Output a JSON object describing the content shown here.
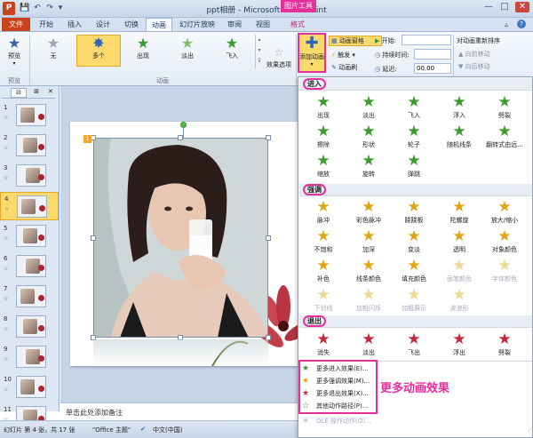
{
  "window": {
    "title": "ppt相册 - Microsoft PowerPoint",
    "logo_letter": "P",
    "contextual_tab_group": "图片工具",
    "min": "—",
    "max": "□",
    "close": "✕"
  },
  "quick_access": [
    "💾",
    "↶",
    "↷",
    "▾"
  ],
  "tabs": {
    "file": "文件",
    "items": [
      "开始",
      "插入",
      "设计",
      "切换",
      "动画",
      "幻灯片放映",
      "审阅",
      "视图"
    ],
    "format": "格式"
  },
  "ribbon": {
    "preview": {
      "label": "预览",
      "group": "预览"
    },
    "animations": [
      {
        "label": "无",
        "icon": "star-none"
      },
      {
        "label": "多个",
        "icon": "star-multi",
        "selected": true
      },
      {
        "label": "出现",
        "icon": "star-appear"
      },
      {
        "label": "淡出",
        "icon": "star-fade"
      },
      {
        "label": "飞入",
        "icon": "star-fly"
      }
    ],
    "effect_options": "效果选项",
    "group_animation": "动画",
    "add_animation": "添加动画",
    "animation_pane": "动画窗格",
    "trigger": "触发",
    "anim_painter": "动画刷",
    "start_label": "开始:",
    "start_value": "",
    "duration_label": "持续时间:",
    "duration_value": "",
    "delay_label": "延迟:",
    "delay_value": "00.00",
    "reorder": "对动画重新排序",
    "move_earlier": "向前移动",
    "move_later": "向后移动"
  },
  "left_pane": {
    "tabs": [
      "⊟",
      "⊞"
    ],
    "slides": [
      {
        "num": "1",
        "star": "☆"
      },
      {
        "num": "2",
        "star": "☆"
      },
      {
        "num": "3",
        "star": "☆"
      },
      {
        "num": "4",
        "star": "☆"
      },
      {
        "num": "5",
        "star": "☆"
      },
      {
        "num": "6",
        "star": "☆"
      },
      {
        "num": "7",
        "star": "☆"
      },
      {
        "num": "8",
        "star": "☆"
      },
      {
        "num": "9",
        "star": "☆"
      },
      {
        "num": "10",
        "star": "☆"
      },
      {
        "num": "11",
        "star": "☆"
      }
    ],
    "current_index": 3
  },
  "slide": {
    "anim_tag": "1"
  },
  "notes": {
    "placeholder": "单击此处添加备注"
  },
  "status": {
    "slide_info": "幻灯片 第 4 张，共 17 张",
    "theme": "\"Office 主题\"",
    "language": "中文(中国)"
  },
  "gallery": {
    "sections": {
      "entrance": "进入",
      "emphasis": "强调",
      "exit": "退出"
    },
    "entrance": [
      {
        "label": "出现",
        "icon": "star"
      },
      {
        "label": "淡出",
        "icon": "star"
      },
      {
        "label": "飞入",
        "icon": "star"
      },
      {
        "label": "浮入",
        "icon": "star"
      },
      {
        "label": "劈裂",
        "icon": "star"
      },
      {
        "label": "擦除",
        "icon": "star"
      },
      {
        "label": "形状",
        "icon": "star"
      },
      {
        "label": "轮子",
        "icon": "star"
      },
      {
        "label": "随机线条",
        "icon": "star"
      },
      {
        "label": "翻转式由远...",
        "icon": "star"
      },
      {
        "label": "缩放",
        "icon": "star"
      },
      {
        "label": "旋转",
        "icon": "star"
      },
      {
        "label": "弹跳",
        "icon": "star"
      }
    ],
    "emphasis": [
      {
        "label": "脉冲",
        "icon": "star",
        "disabled": false
      },
      {
        "label": "彩色脉冲",
        "icon": "star",
        "disabled": false
      },
      {
        "label": "跷跷板",
        "icon": "star",
        "disabled": false
      },
      {
        "label": "陀螺旋",
        "icon": "star",
        "disabled": false
      },
      {
        "label": "放大/缩小",
        "icon": "star",
        "disabled": false
      },
      {
        "label": "不饱和",
        "icon": "star",
        "disabled": false
      },
      {
        "label": "加深",
        "icon": "star",
        "disabled": false
      },
      {
        "label": "变淡",
        "icon": "star",
        "disabled": false
      },
      {
        "label": "透明",
        "icon": "star",
        "disabled": false
      },
      {
        "label": "对象颜色",
        "icon": "star",
        "disabled": false
      },
      {
        "label": "补色",
        "icon": "star",
        "disabled": false
      },
      {
        "label": "线条颜色",
        "icon": "star",
        "disabled": false
      },
      {
        "label": "填充颜色",
        "icon": "star",
        "disabled": false
      },
      {
        "label": "画笔颜色",
        "icon": "star",
        "disabled": true
      },
      {
        "label": "字体颜色",
        "icon": "star",
        "disabled": true
      },
      {
        "label": "下划线",
        "icon": "star",
        "disabled": true
      },
      {
        "label": "加粗闪烁",
        "icon": "star",
        "disabled": true
      },
      {
        "label": "加粗展示",
        "icon": "star",
        "disabled": true
      },
      {
        "label": "波浪形",
        "icon": "star",
        "disabled": true
      }
    ],
    "exit": [
      {
        "label": "消失",
        "icon": "star"
      },
      {
        "label": "淡出",
        "icon": "star"
      },
      {
        "label": "飞出",
        "icon": "star"
      },
      {
        "label": "浮出",
        "icon": "star"
      },
      {
        "label": "劈裂",
        "icon": "star"
      }
    ],
    "more": [
      {
        "label": "更多进入效果(E)...",
        "icon": "★"
      },
      {
        "label": "更多强调效果(M)...",
        "icon": "★"
      },
      {
        "label": "更多退出效果(X)...",
        "icon": "★"
      },
      {
        "label": "其他动作路径(P)...",
        "icon": "☆"
      }
    ],
    "ole": "OLE 操作动作(O)..."
  },
  "annotation": "更多动画效果",
  "colors": {
    "file_tab": "#c8431c",
    "highlight_pink": "#e4309b",
    "entrance_green": "#3d9a2f",
    "emphasis_gold": "#e0a414",
    "exit_red": "#c8263c",
    "ribbon_blue": "#d5e1f0"
  }
}
